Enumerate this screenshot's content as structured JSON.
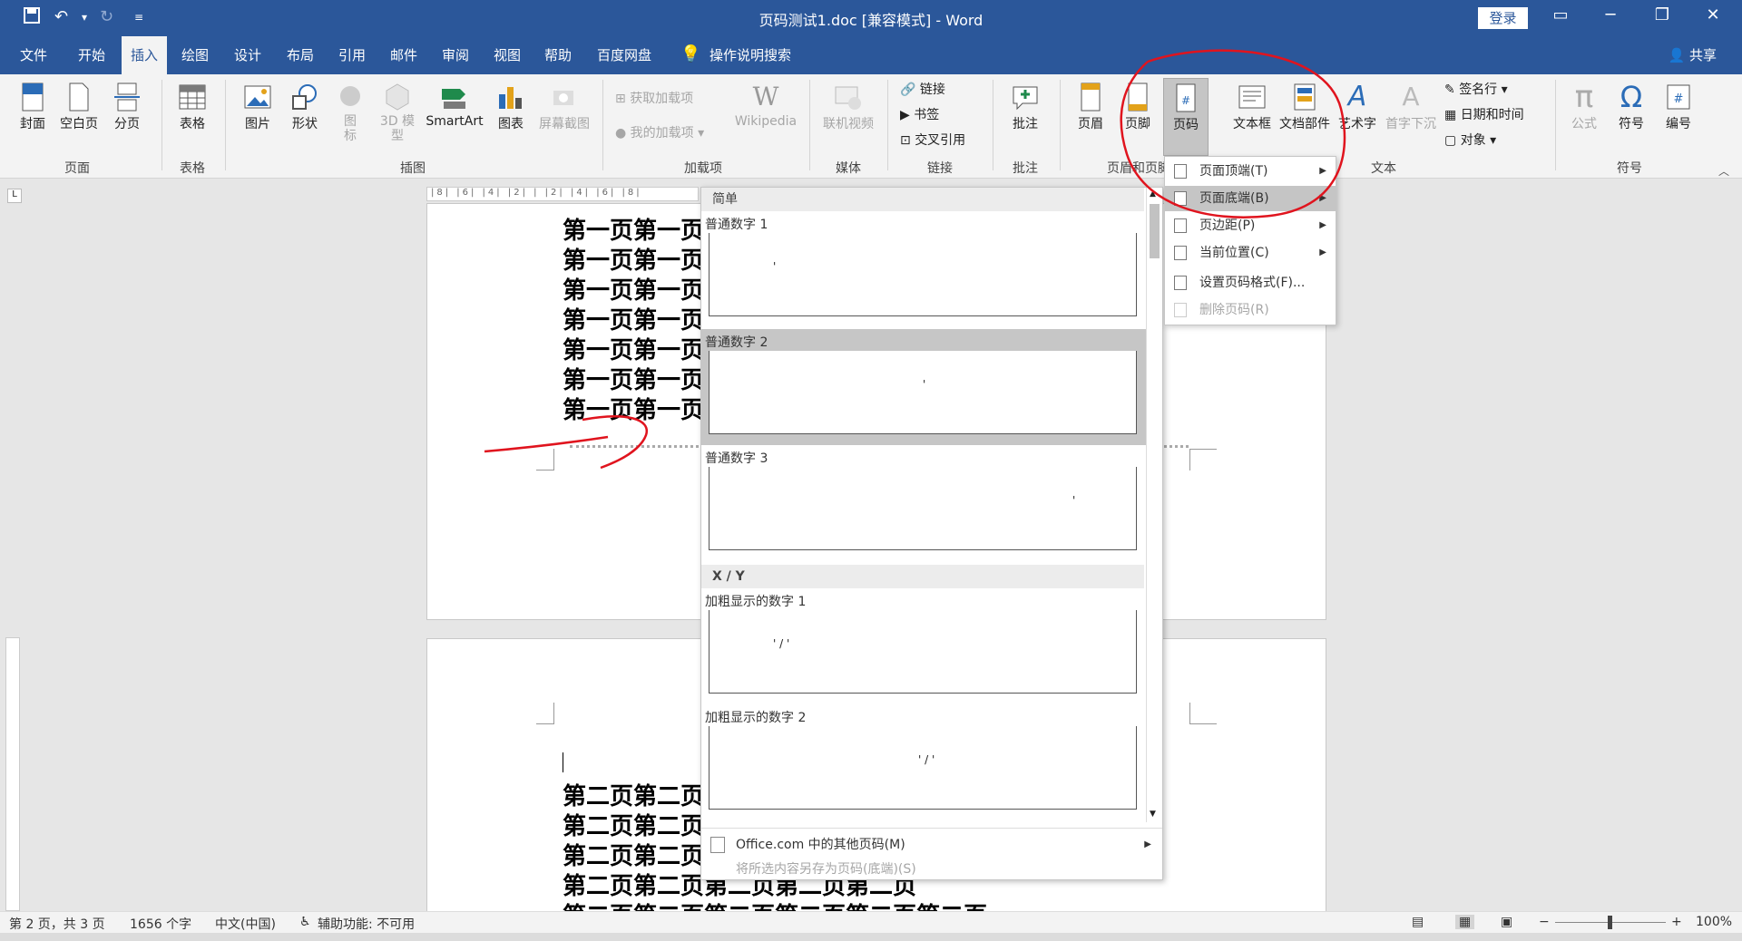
{
  "titlebar": {
    "title": "页码测试1.doc [兼容模式] - Word",
    "login": "登录"
  },
  "menu": {
    "tabs": [
      "文件",
      "开始",
      "插入",
      "绘图",
      "设计",
      "布局",
      "引用",
      "邮件",
      "审阅",
      "视图",
      "帮助",
      "百度网盘",
      "操作说明搜索"
    ],
    "active": "插入",
    "share": "共享"
  },
  "ribbon": {
    "page": {
      "cover": "封面",
      "blank": "空白页",
      "break": "分页",
      "group": "页面"
    },
    "table": {
      "table": "表格",
      "group": "表格"
    },
    "illus": {
      "picture": "图片",
      "shapes": "形状",
      "icons_line1": "图",
      "icons_line2": "标",
      "model_line1": "3D 模",
      "model_line2": "型",
      "smartart": "SmartArt",
      "chart": "图表",
      "screenshot": "屏幕截图",
      "group": "插图"
    },
    "addins": {
      "get": "获取加载项",
      "mine": "我的加载项",
      "wiki": "Wikipedia",
      "group": "加载项"
    },
    "media": {
      "video": "联机视频",
      "group": "媒体"
    },
    "links": {
      "link": "链接",
      "bookmark": "书签",
      "crossref": "交叉引用",
      "group": "链接"
    },
    "comments": {
      "comment": "批注",
      "group": "批注"
    },
    "hf": {
      "header": "页眉",
      "footer": "页脚",
      "pagenum": "页码",
      "group": "页眉和页脚"
    },
    "text": {
      "textbox": "文本框",
      "parts": "文档部件",
      "wordart": "艺术字",
      "dropcap": "首字下沉",
      "sigline": "签名行",
      "datetime": "日期和时间",
      "object": "对象",
      "group": "文本"
    },
    "symbols": {
      "equation": "公式",
      "symbol": "符号",
      "number": "编号",
      "group": "符号"
    }
  },
  "document": {
    "page1_line": "第一页第一页",
    "page2_line": "第二页第二页",
    "page2_last": "第二页第二页第二页第二页第二页",
    "page2_cut": "第二页第二页第二页第二页第二页第二页"
  },
  "gallery": {
    "section_simple": "简单",
    "items": [
      {
        "label": "普通数字 1",
        "glyph": "'"
      },
      {
        "label": "普通数字 2",
        "glyph": "'"
      },
      {
        "label": "普通数字 3",
        "glyph": "'"
      }
    ],
    "section_xy": "X / Y",
    "bold_items": [
      {
        "label": "加粗显示的数字 1",
        "glyph": "' / '"
      },
      {
        "label": "加粗显示的数字 2",
        "glyph": "' / '"
      }
    ],
    "more": "Office.com 中的其他页码(M)",
    "save": "将所选内容另存为页码(底端)(S)"
  },
  "submenu": {
    "items": [
      {
        "label": "页面顶端(T)",
        "arrow": true,
        "disabled": false
      },
      {
        "label": "页面底端(B)",
        "arrow": true,
        "disabled": false
      },
      {
        "label": "页边距(P)",
        "arrow": true,
        "disabled": false
      },
      {
        "label": "当前位置(C)",
        "arrow": true,
        "disabled": false
      },
      {
        "label": "设置页码格式(F)...",
        "arrow": false,
        "disabled": false
      },
      {
        "label": "删除页码(R)",
        "arrow": false,
        "disabled": true
      }
    ],
    "highlighted": 1
  },
  "status": {
    "page": "第 2 页，共 3 页",
    "words": "1656 个字",
    "lang": "中文(中国)",
    "access": "辅助功能: 不可用",
    "zoom": "100%"
  },
  "colors": {
    "accent": "#2b579a",
    "annotation": "#e0141e"
  }
}
